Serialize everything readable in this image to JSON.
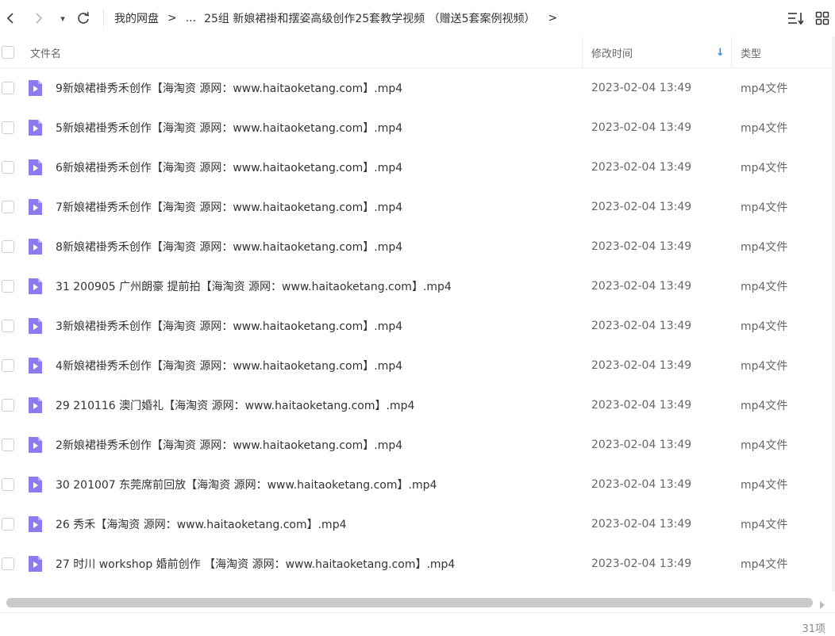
{
  "toolbar": {
    "back_icon": "chevron-left-icon",
    "forward_icon": "chevron-right-icon",
    "dropdown_glyph": "▾",
    "refresh_icon": "refresh-icon"
  },
  "breadcrumb": {
    "root": "我的网盘",
    "sep": ">",
    "ellipsis": "...",
    "current": "25组 新娘裙褂和摆姿高级创作25套教学视频 （赠送5套案例视频）",
    "trailing_sep": ">"
  },
  "header": {
    "name": "文件名",
    "mtime": "修改时间",
    "type": "类型",
    "sort_glyph": "↓"
  },
  "files": [
    {
      "name": "9新娘裙褂秀禾创作【海淘资 源网：www.haitaoketang.com】.mp4",
      "mtime": "2023-02-04 13:49",
      "type": "mp4文件"
    },
    {
      "name": "5新娘裙褂秀禾创作【海淘资 源网：www.haitaoketang.com】.mp4",
      "mtime": "2023-02-04 13:49",
      "type": "mp4文件"
    },
    {
      "name": "6新娘裙褂秀禾创作【海淘资 源网：www.haitaoketang.com】.mp4",
      "mtime": "2023-02-04 13:49",
      "type": "mp4文件"
    },
    {
      "name": "7新娘裙褂秀禾创作【海淘资 源网：www.haitaoketang.com】.mp4",
      "mtime": "2023-02-04 13:49",
      "type": "mp4文件"
    },
    {
      "name": "8新娘裙褂秀禾创作【海淘资 源网：www.haitaoketang.com】.mp4",
      "mtime": "2023-02-04 13:49",
      "type": "mp4文件"
    },
    {
      "name": "31 200905 广州朗豪 提前拍【海淘资 源网：www.haitaoketang.com】.mp4",
      "mtime": "2023-02-04 13:49",
      "type": "mp4文件"
    },
    {
      "name": "3新娘裙褂秀禾创作【海淘资 源网：www.haitaoketang.com】.mp4",
      "mtime": "2023-02-04 13:49",
      "type": "mp4文件"
    },
    {
      "name": "4新娘裙褂秀禾创作【海淘资 源网：www.haitaoketang.com】.mp4",
      "mtime": "2023-02-04 13:49",
      "type": "mp4文件"
    },
    {
      "name": "29 210116 澳门婚礼【海淘资 源网：www.haitaoketang.com】.mp4",
      "mtime": "2023-02-04 13:49",
      "type": "mp4文件"
    },
    {
      "name": "2新娘裙褂秀禾创作【海淘资 源网：www.haitaoketang.com】.mp4",
      "mtime": "2023-02-04 13:49",
      "type": "mp4文件"
    },
    {
      "name": "30 201007 东莞席前回放【海淘资 源网：www.haitaoketang.com】.mp4",
      "mtime": "2023-02-04 13:49",
      "type": "mp4文件"
    },
    {
      "name": "26 秀禾【海淘资 源网：www.haitaoketang.com】.mp4",
      "mtime": "2023-02-04 13:49",
      "type": "mp4文件"
    },
    {
      "name": "27 时川 workshop 婚前创作 【海淘资 源网：www.haitaoketang.com】.mp4",
      "mtime": "2023-02-04 13:49",
      "type": "mp4文件"
    }
  ],
  "status": {
    "count": "31项"
  },
  "colors": {
    "file_icon": "#8a7cf0",
    "sort_arrow": "#2b8cf5"
  }
}
